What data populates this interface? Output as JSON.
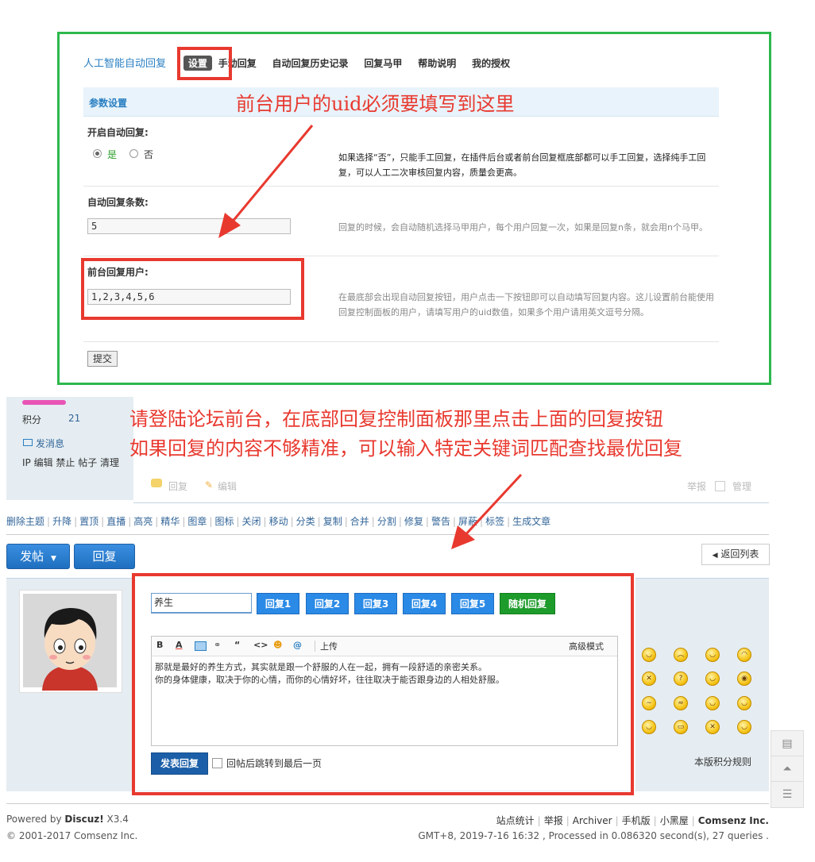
{
  "admin_panel": {
    "title": "人工智能自动回复",
    "tabs": [
      "设置",
      "手动回复",
      "自动回复历史记录",
      "回复马甲",
      "帮助说明",
      "我的授权"
    ],
    "section_header": "参数设置",
    "annotation_uid": "前台用户的uid必须要填写到这里",
    "auto_reply": {
      "label": "开启自动回复:",
      "option_yes": "是",
      "option_no": "否",
      "selected": "是",
      "desc": "如果选择“否”，只能手工回复，在插件后台或者前台回复框底部都可以手工回复，选择纯手工回复，可以人工二次审核回复内容，质量会更高。"
    },
    "reply_count": {
      "label": "自动回复条数:",
      "value": "5",
      "desc": "回复的时候，会自动随机选择马甲用户，每个用户回复一次，如果是回复n条，就会用n个马甲。"
    },
    "front_users": {
      "label": "前台回复用户:",
      "value": "1,2,3,4,5,6",
      "desc": "在最底部会出现自动回复按钮，用户点击一下按钮即可以自动填写回复内容。这儿设置前台能使用回复控制面板的用户，请填写用户的uid数值，如果多个用户请用英文逗号分隔。"
    },
    "submit_label": "提交"
  },
  "annotation_forum": {
    "line1": "请登陆论坛前台，在底部回复控制面板那里点击上面的回复按钮",
    "line2": "如果回复的内容不够精准，可以输入特定关键词匹配查找最优回复"
  },
  "forum": {
    "sidebar": {
      "points_label": "积分",
      "points_value": "21",
      "send_message": "发消息",
      "admin_links": "IP 编辑 禁止 帖子 清理"
    },
    "post_actions": {
      "reply": "回复",
      "edit": "编辑",
      "report": "举报",
      "manage": "管理"
    },
    "mod_tools": [
      "删除主题",
      "升降",
      "置顶",
      "直播",
      "高亮",
      "精华",
      "图章",
      "图标",
      "关闭",
      "移动",
      "分类",
      "复制",
      "合并",
      "分割",
      "修复",
      "警告",
      "屏蔽",
      "标签",
      "生成文章"
    ],
    "new_post_button": "发帖",
    "reply_button": "回复",
    "back_button": "返回列表",
    "quick_reply": {
      "keyword_value": "养生",
      "reply_buttons": [
        "回复1",
        "回复2",
        "回复3",
        "回复4",
        "回复5"
      ],
      "random_button": "随机回复",
      "toolbar": {
        "upload": "上传",
        "advanced": "高级模式"
      },
      "content_line1": "那就是最好的养生方式，其实就是跟一个舒服的人在一起，拥有一段舒适的亲密关系。",
      "content_line2": "你的身体健康，取决于你的心情，而你的心情好坏，往往取决于能否跟身边的人相处舒服。",
      "submit": "发表回复",
      "jump_label": "回帖后跳转到最后一页",
      "rules_link": "本版积分规则"
    }
  },
  "footer": {
    "powered_prefix": "Powered by ",
    "powered_brand": "Discuz!",
    "powered_version": " X3.4",
    "copyright": "© 2001-2017 Comsenz Inc.",
    "links": [
      "站点统计",
      "举报",
      "Archiver",
      "手机版",
      "小黑屋"
    ],
    "company": "Comsenz Inc.",
    "stats": "GMT+8, 2019-7-16 16:32 , Processed in 0.086320 second(s), 27 queries ."
  },
  "colors": {
    "annotation_red": "#e8392f",
    "frame_green": "#2db84d",
    "link_blue": "#336699",
    "button_blue": "#2a8ae6",
    "random_green": "#1d9b2b"
  }
}
